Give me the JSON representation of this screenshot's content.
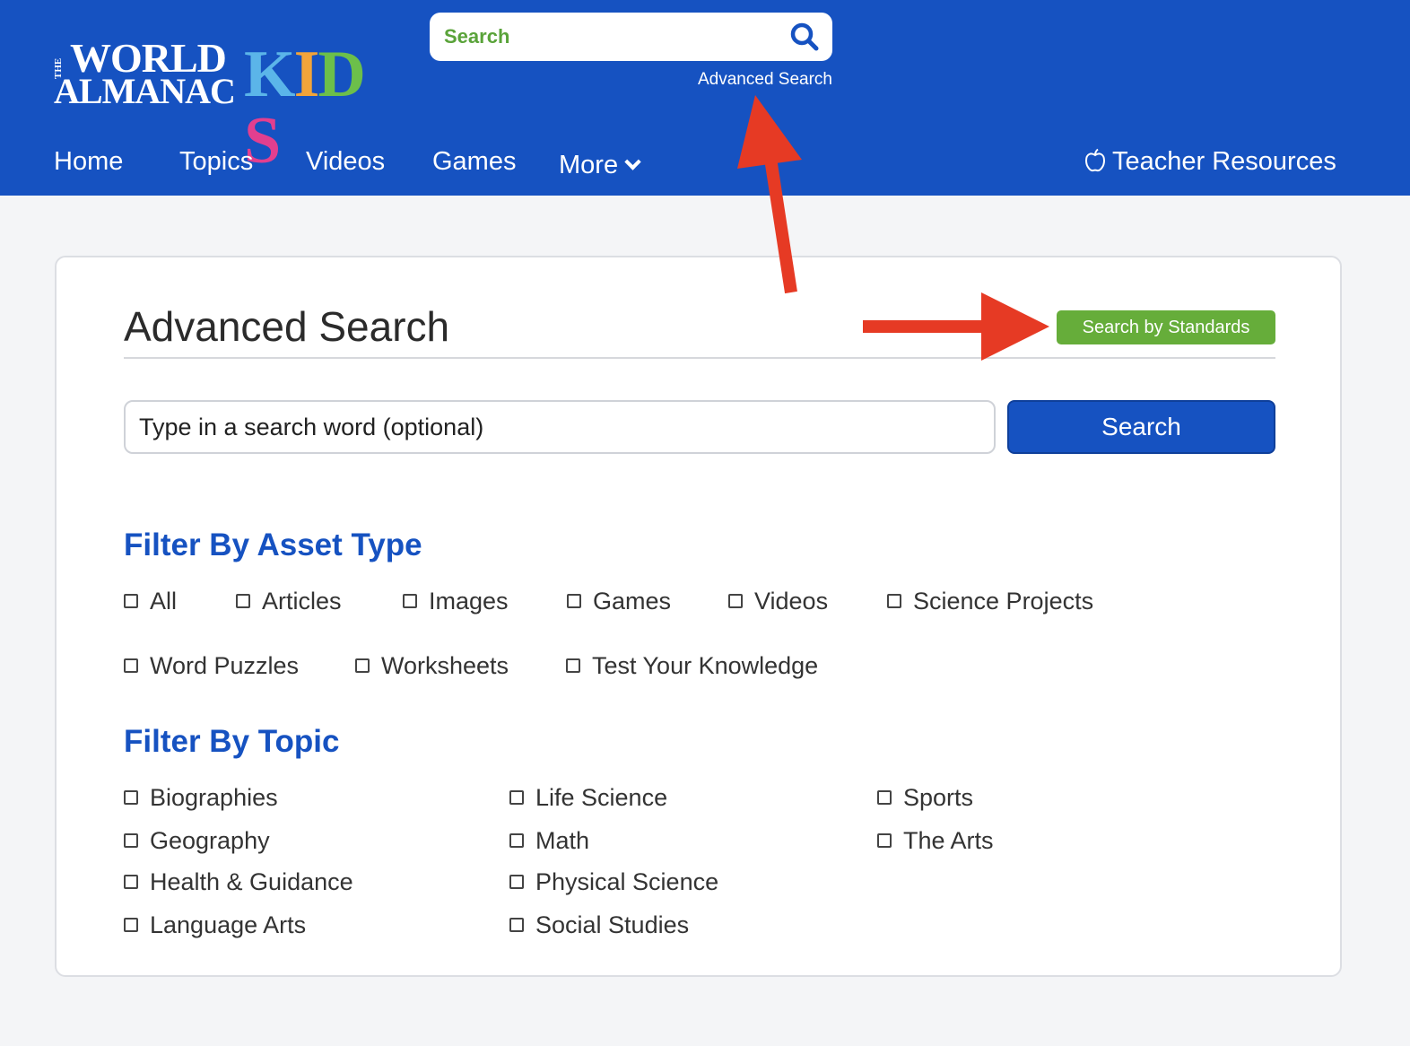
{
  "header": {
    "logo": {
      "the": "THE",
      "world": "WORLD",
      "almanac": "ALMANAC",
      "kids": [
        "K",
        "I",
        "D",
        "S"
      ],
      "kids_colors": [
        "#5bb5e9",
        "#f2a43a",
        "#6cbf4a",
        "#e23f8f"
      ]
    },
    "search": {
      "placeholder": "Search"
    },
    "advanced_search_link": "Advanced Search",
    "nav": [
      "Home",
      "Topics",
      "Videos",
      "Games",
      "More"
    ],
    "teacher_resources": "Teacher Resources",
    "colors": {
      "brand_blue": "#1652c1",
      "accent_green": "#66ad3a"
    }
  },
  "main": {
    "title": "Advanced Search",
    "standards_button": "Search by Standards",
    "search_input_placeholder": "Type in a search word (optional)",
    "search_button": "Search",
    "asset_filter": {
      "heading": "Filter By Asset Type",
      "options": [
        "All",
        "Articles",
        "Images",
        "Games",
        "Videos",
        "Science Projects",
        "Word Puzzles",
        "Worksheets",
        "Test Your Knowledge"
      ]
    },
    "topic_filter": {
      "heading": "Filter By Topic",
      "options": [
        "Biographies",
        "Geography",
        "Health & Guidance",
        "Language Arts",
        "Life Science",
        "Math",
        "Physical Science",
        "Social Studies",
        "Sports",
        "The Arts"
      ]
    }
  }
}
